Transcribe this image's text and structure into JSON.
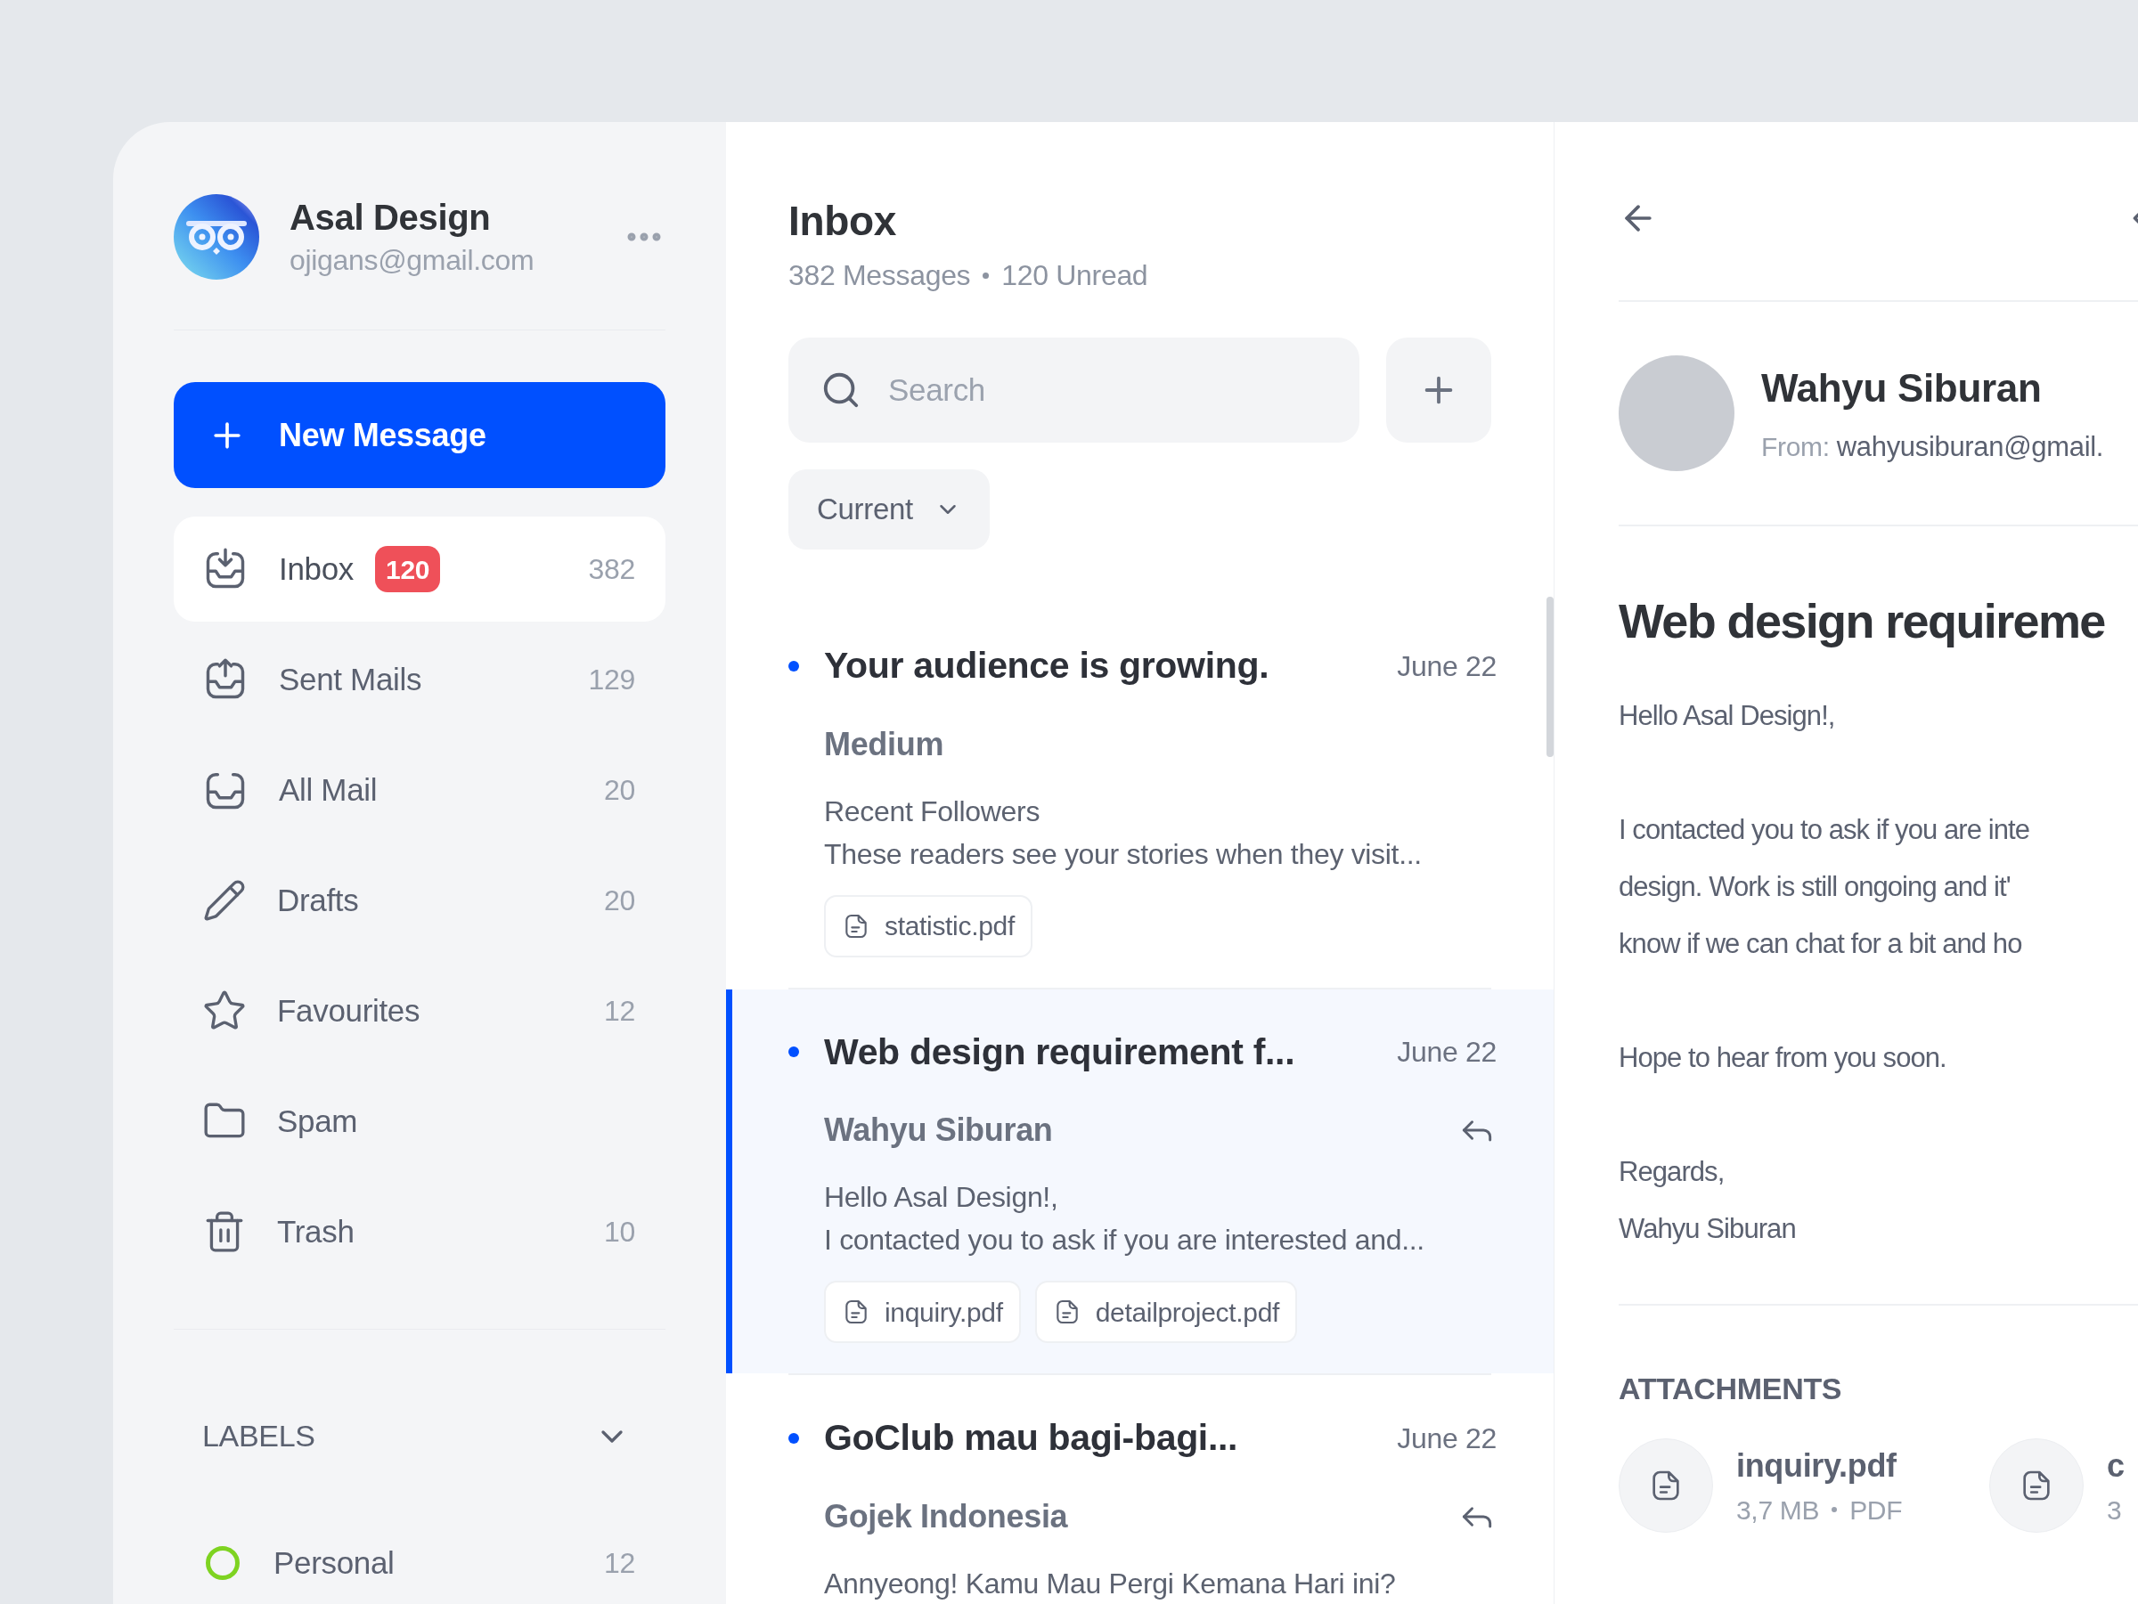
{
  "account": {
    "name": "Asal Design",
    "email": "ojigans@gmail.com"
  },
  "new_message_button": "New Message",
  "nav": [
    {
      "label": "Inbox",
      "badge": "120",
      "count": "382",
      "selected": true
    },
    {
      "label": "Sent Mails",
      "count": "129",
      "selected": false
    },
    {
      "label": "All Mail",
      "count": "20",
      "selected": false
    },
    {
      "label": "Drafts",
      "count": "20",
      "selected": false
    },
    {
      "label": "Favourites",
      "count": "12",
      "selected": false
    },
    {
      "label": "Spam",
      "selected": false
    },
    {
      "label": "Trash",
      "count": "10",
      "selected": false
    }
  ],
  "labels": {
    "title": "LABELS",
    "expanded": true,
    "items": [
      {
        "label": "Personal",
        "count": "12",
        "color": "#7ed321"
      }
    ]
  },
  "inbox": {
    "title": "Inbox",
    "messages_count": "382 Messages",
    "unread_count": "120 Unread",
    "search_placeholder": "Search",
    "filter": "Current"
  },
  "messages": [
    {
      "title": "Your audience is growing.",
      "date": "June 22",
      "sender": "Medium",
      "preview": [
        "Recent Followers",
        "These readers see your stories when they visit..."
      ],
      "attachments": [
        "statistic.pdf"
      ],
      "unread": true,
      "replied": false,
      "selected": false
    },
    {
      "title": "Web design requirement f...",
      "date": "June 22",
      "sender": "Wahyu Siburan",
      "preview": [
        "Hello Asal Design!,",
        "I contacted you to ask if you are interested and..."
      ],
      "attachments": [
        "inquiry.pdf",
        "detailproject.pdf"
      ],
      "unread": true,
      "replied": true,
      "selected": true
    },
    {
      "title": "GoClub mau bagi-bagi...",
      "date": "June 22",
      "sender": "Gojek Indonesia",
      "preview": [
        "Annyeong! Kamu Mau Pergi Kemana Hari ini?"
      ],
      "unread": true,
      "replied": true,
      "selected": false
    }
  ],
  "detail": {
    "sender": "Wahyu Siburan",
    "from_label": "From:",
    "from_email": "wahyusiburan@gmail.",
    "subject": "Web design requireme",
    "body": [
      [
        "Hello Asal Design!,"
      ],
      [
        "I contacted you to ask if you are inte",
        "design. Work is still ongoing and it'",
        "know if we can chat for a bit and ho"
      ],
      [
        "Hope to hear from you soon."
      ],
      [
        "Regards,",
        "Wahyu Siburan"
      ]
    ],
    "attachments_title": "ATTACHMENTS",
    "attachments": [
      {
        "name": "inquiry.pdf",
        "size": "3,7 MB",
        "type": "PDF"
      },
      {
        "name": "c",
        "size": "3"
      }
    ]
  }
}
